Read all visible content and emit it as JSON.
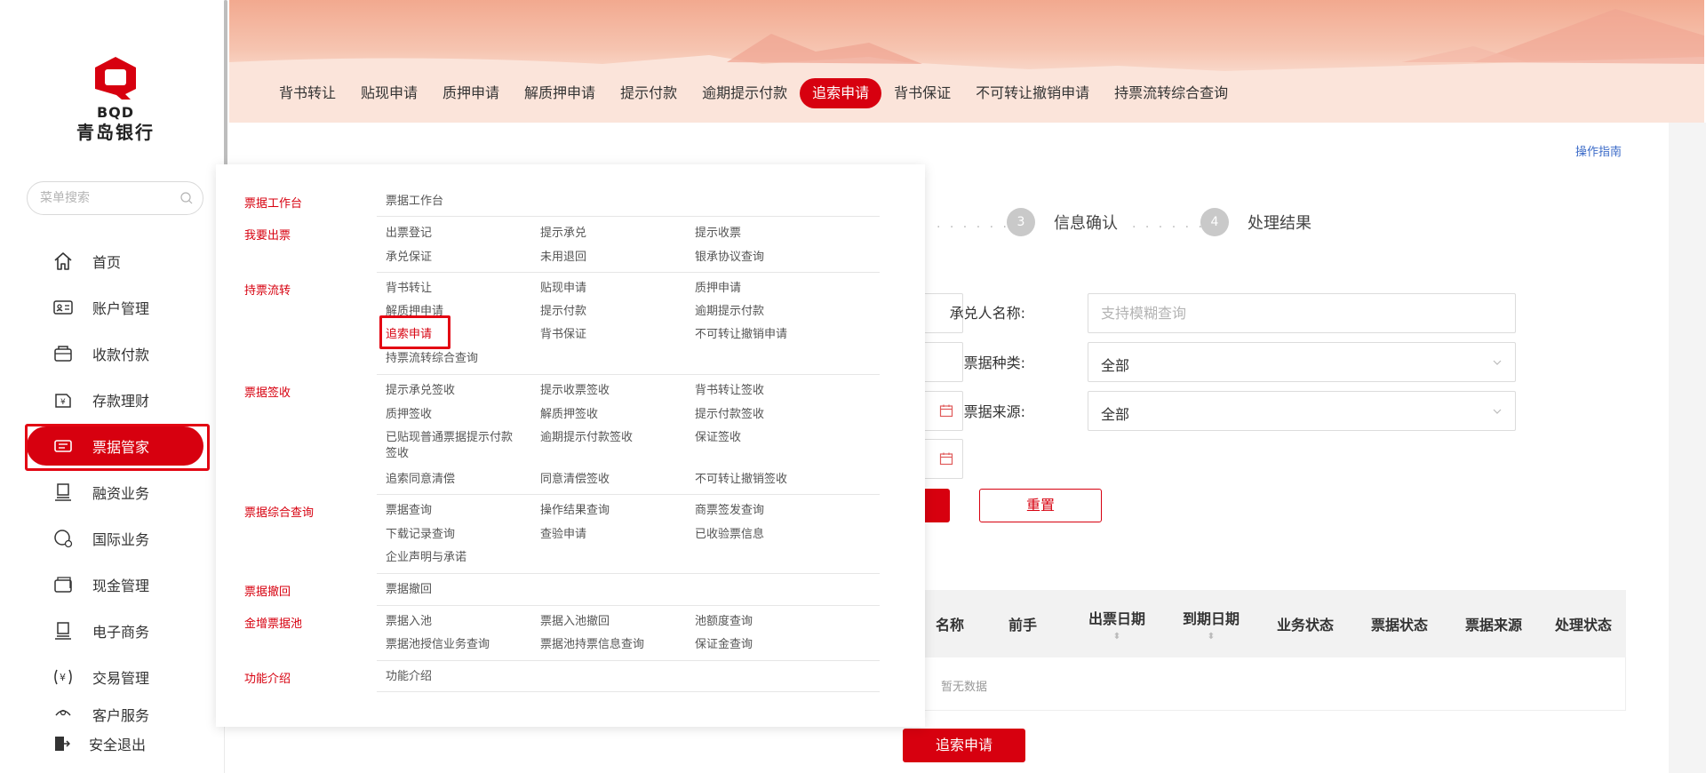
{
  "brand": {
    "name_en": "BQD",
    "name_cn": "青岛银行",
    "color": "#d7000f"
  },
  "sidebar": {
    "search_placeholder": "菜单搜索",
    "items": [
      {
        "label": "首页",
        "icon": "home-icon"
      },
      {
        "label": "账户管理",
        "icon": "id-card-icon"
      },
      {
        "label": "收款付款",
        "icon": "wallet-icon"
      },
      {
        "label": "存款理财",
        "icon": "deposit-icon"
      },
      {
        "label": "票据管家",
        "icon": "ticket-icon",
        "active": true
      },
      {
        "label": "融资业务",
        "icon": "finance-icon"
      },
      {
        "label": "国际业务",
        "icon": "globe-icon"
      },
      {
        "label": "现金管理",
        "icon": "cash-icon"
      },
      {
        "label": "电子商务",
        "icon": "ecommerce-icon"
      },
      {
        "label": "交易管理",
        "icon": "yuan-icon"
      },
      {
        "label": "客户服务",
        "icon": "service-icon"
      }
    ],
    "logout_label": "安全退出"
  },
  "tabs": [
    "背书转让",
    "贴现申请",
    "质押申请",
    "解质押申请",
    "提示付款",
    "逾期提示付款",
    "追索申请",
    "背书保证",
    "不可转让撤销申请",
    "持票流转综合查询"
  ],
  "active_tab": "追索申请",
  "guide_link": "操作指南",
  "steps": [
    {
      "num": "3",
      "label": "信息确认"
    },
    {
      "num": "4",
      "label": "处理结果"
    }
  ],
  "form": {
    "acceptor_label": "承兑人名称:",
    "acceptor_placeholder": "支持模糊查询",
    "bill_type_label": "票据种类:",
    "bill_type_value": "全部",
    "bill_source_label": "票据来源:",
    "bill_source_value": "全部",
    "reset_label": "重置"
  },
  "table": {
    "headers": [
      {
        "label": "名称",
        "sortable": false
      },
      {
        "label": "前手",
        "sortable": false
      },
      {
        "label": "出票日期",
        "sortable": true
      },
      {
        "label": "到期日期",
        "sortable": true
      },
      {
        "label": "业务状态",
        "sortable": false
      },
      {
        "label": "票据状态",
        "sortable": false
      },
      {
        "label": "票据来源",
        "sortable": false
      },
      {
        "label": "处理状态",
        "sortable": false
      }
    ],
    "empty_text": "暂无数据"
  },
  "submit_label": "追索申请",
  "mega_menu": {
    "categories": [
      {
        "name": "票据工作台",
        "links": [
          "票据工作台"
        ]
      },
      {
        "name": "我要出票",
        "links": [
          "出票登记",
          "提示承兑",
          "提示收票",
          "承兑保证",
          "未用退回",
          "银承协议查询"
        ]
      },
      {
        "name": "持票流转",
        "links": [
          "背书转让",
          "贴现申请",
          "质押申请",
          "解质押申请",
          "提示付款",
          "逾期提示付款",
          "追索申请",
          "背书保证",
          "不可转让撤销申请",
          "持票流转综合查询"
        ]
      },
      {
        "name": "票据签收",
        "links": [
          "提示承兑签收",
          "提示收票签收",
          "背书转让签收",
          "质押签收",
          "解质押签收",
          "提示付款签收",
          "已贴现普通票据提示付款签收",
          "逾期提示付款签收",
          "保证签收",
          "追索同意清偿",
          "同意清偿签收",
          "不可转让撤销签收"
        ]
      },
      {
        "name": "票据综合查询",
        "links": [
          "票据查询",
          "操作结果查询",
          "商票签发查询",
          "下载记录查询",
          "查验申请",
          "已收验票信息",
          "企业声明与承诺"
        ]
      },
      {
        "name": "票据撤回",
        "links": [
          "票据撤回"
        ]
      },
      {
        "name": "金增票据池",
        "links": [
          "票据入池",
          "票据入池撤回",
          "池额度查询",
          "票据池授信业务查询",
          "票据池持票信息查询",
          "保证金查询"
        ]
      },
      {
        "name": "功能介绍",
        "links": [
          "功能介绍"
        ]
      }
    ],
    "highlighted_link": "追索申请"
  }
}
